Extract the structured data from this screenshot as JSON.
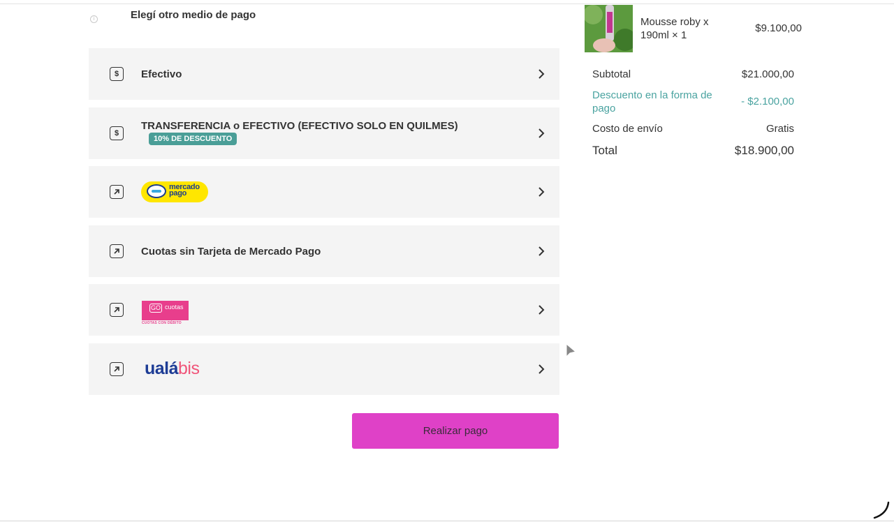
{
  "section": {
    "title": "Elegí otro medio de pago",
    "info_icon": "i"
  },
  "payment_methods": [
    {
      "label": "Efectivo",
      "icon": "dollar-icon",
      "icon_text": "$"
    },
    {
      "label": "TRANSFERENCIA o EFECTIVO (EFECTIVO SOLO EN QUILMES)",
      "icon": "dollar-icon",
      "icon_text": "$",
      "badge": "10% DE DESCUENTO"
    },
    {
      "logo": "mercado-pago-logo",
      "logo_text_1": "mercado",
      "logo_text_2": "pago",
      "icon": "external-link-icon"
    },
    {
      "label": "Cuotas sin Tarjeta de Mercado Pago",
      "icon": "external-link-icon"
    },
    {
      "logo": "go-cuotas-logo",
      "logo_box": "GO",
      "logo_word": "cuotas",
      "logo_sub": "CUOTAS CON DÉBITO",
      "icon": "external-link-icon"
    },
    {
      "logo": "uala-bis-logo",
      "logo_text_a": "ualá",
      "logo_text_b": "bis",
      "icon": "external-link-icon"
    }
  ],
  "actions": {
    "pay_button": "Realizar pago"
  },
  "cart": {
    "product": {
      "name": "Mousse roby x 190ml × 1",
      "price": "$9.100,00"
    },
    "summary": {
      "subtotal_label": "Subtotal",
      "subtotal_value": "$21.000,00",
      "discount_label": "Descuento en la forma de pago",
      "discount_value": "- $2.100,00",
      "shipping_label": "Costo de envío",
      "shipping_value": "Gratis",
      "total_label": "Total",
      "total_value": "$18.900,00"
    }
  },
  "colors": {
    "accent_button": "#df41c7",
    "discount_teal": "#4a9e97",
    "mercado_pago_yellow": "#ffe600",
    "go_cuotas_pink": "#e83e8c",
    "uala_blue": "#1d3c95",
    "uala_pink": "#f0557a"
  }
}
